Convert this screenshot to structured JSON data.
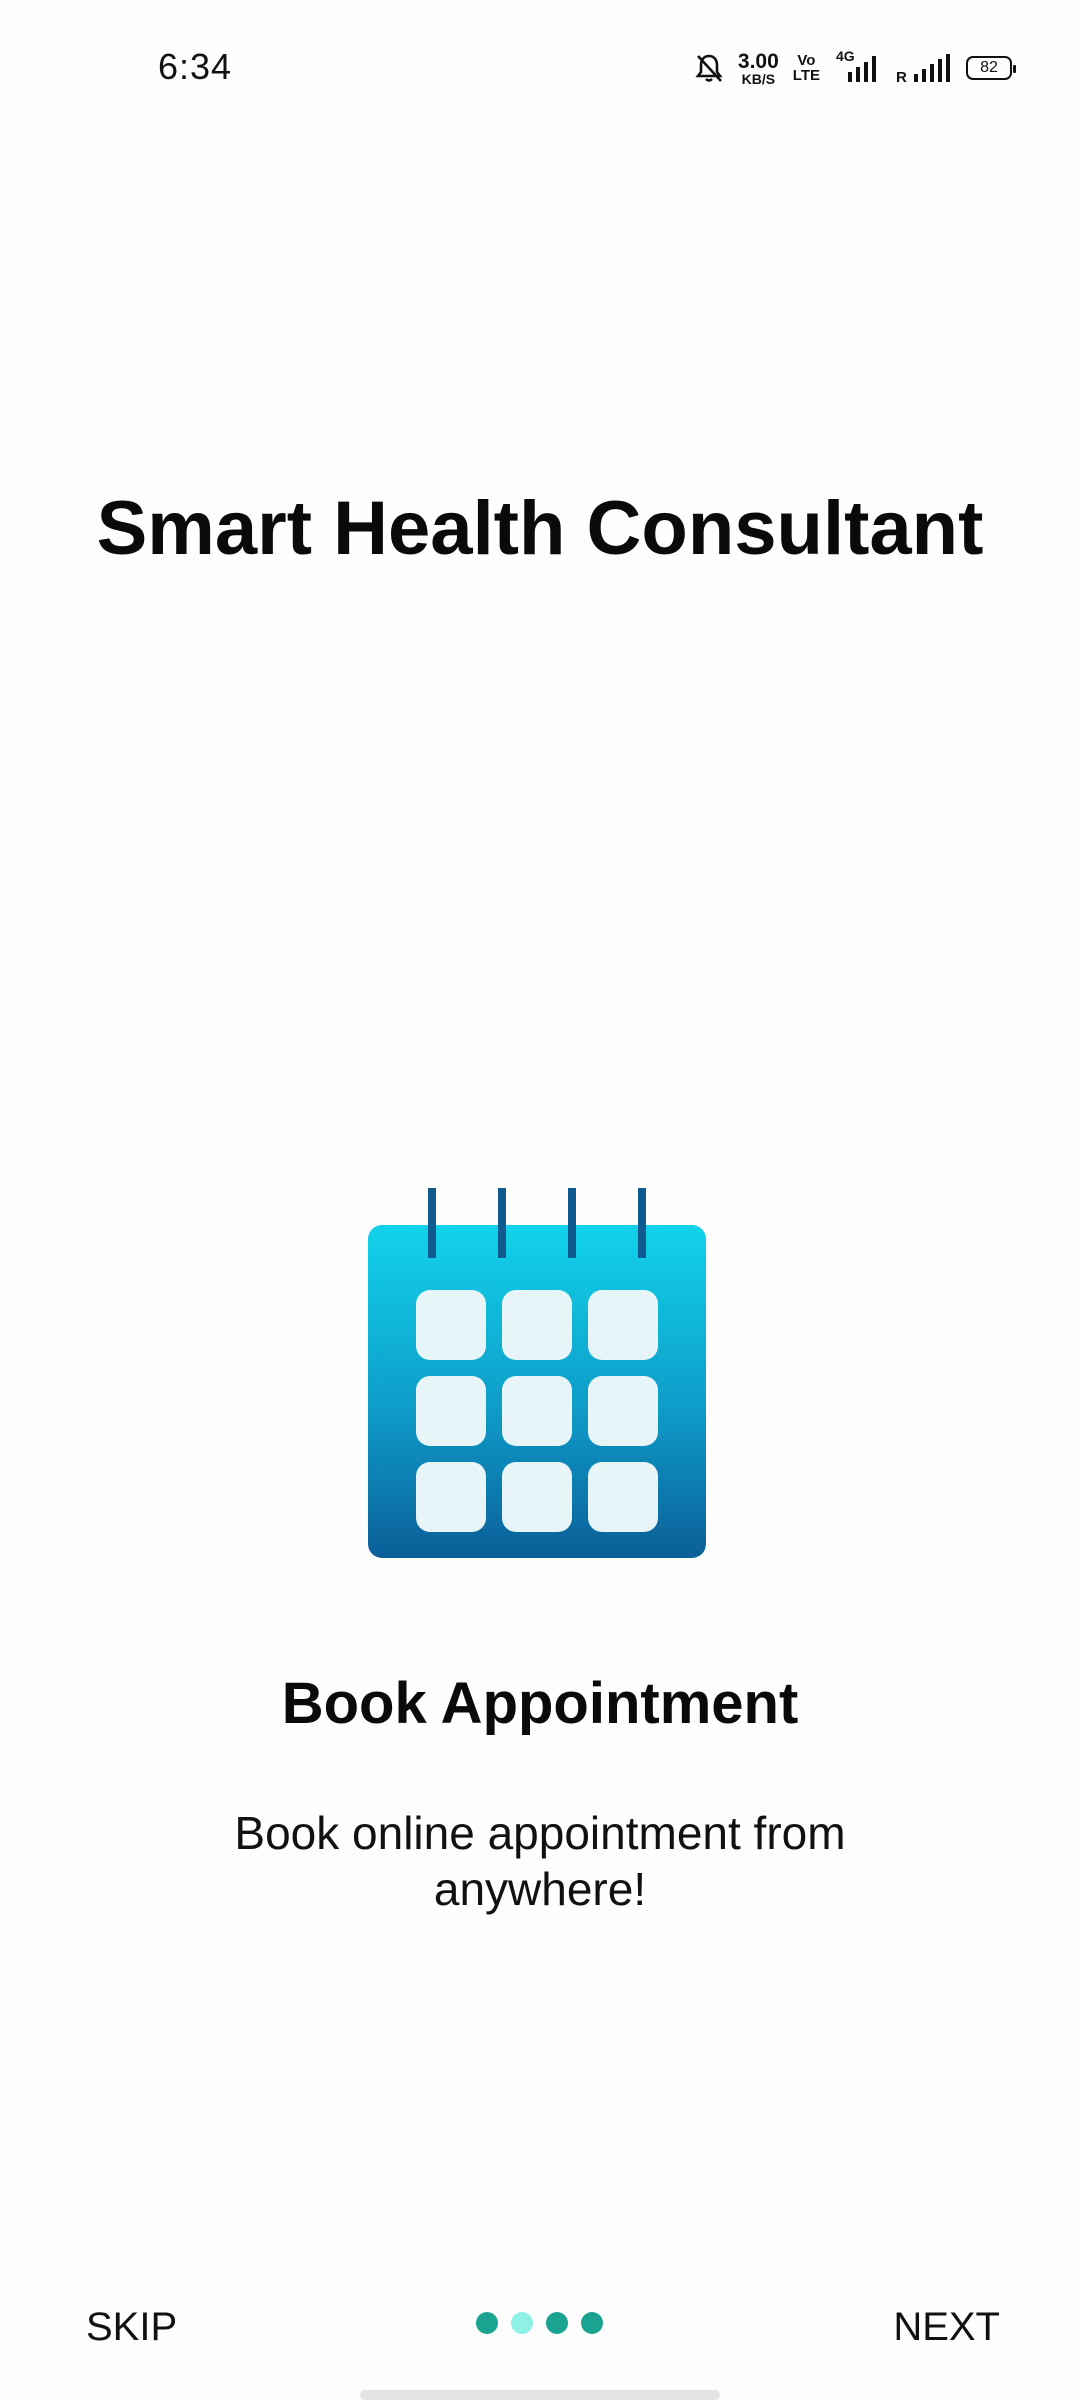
{
  "status_bar": {
    "time": "6:34",
    "net_speed_value": "3.00",
    "net_speed_unit": "KB/S",
    "volte_top": "Vo",
    "volte_bottom": "LTE",
    "network_type": "4G",
    "roaming": "R",
    "battery": "82",
    "icons": [
      "mute-bell-icon",
      "signal-icon",
      "signal-icon"
    ]
  },
  "header": {
    "title": "Smart Health Consultant"
  },
  "slide": {
    "icon": "calendar-icon",
    "title": "Book Appointment",
    "description": "Book online appointment from anywhere!"
  },
  "pager": {
    "total": 4,
    "current": 2
  },
  "nav": {
    "skip_label": "SKIP",
    "next_label": "NEXT"
  },
  "colors": {
    "calendar_top": "#12d3ea",
    "calendar_bottom": "#0b5f98",
    "calendar_rings": "#0f5a8e",
    "calendar_cell": "#e8f5f8",
    "dot": "#1aa391",
    "dot_active": "#8ff0e4"
  }
}
